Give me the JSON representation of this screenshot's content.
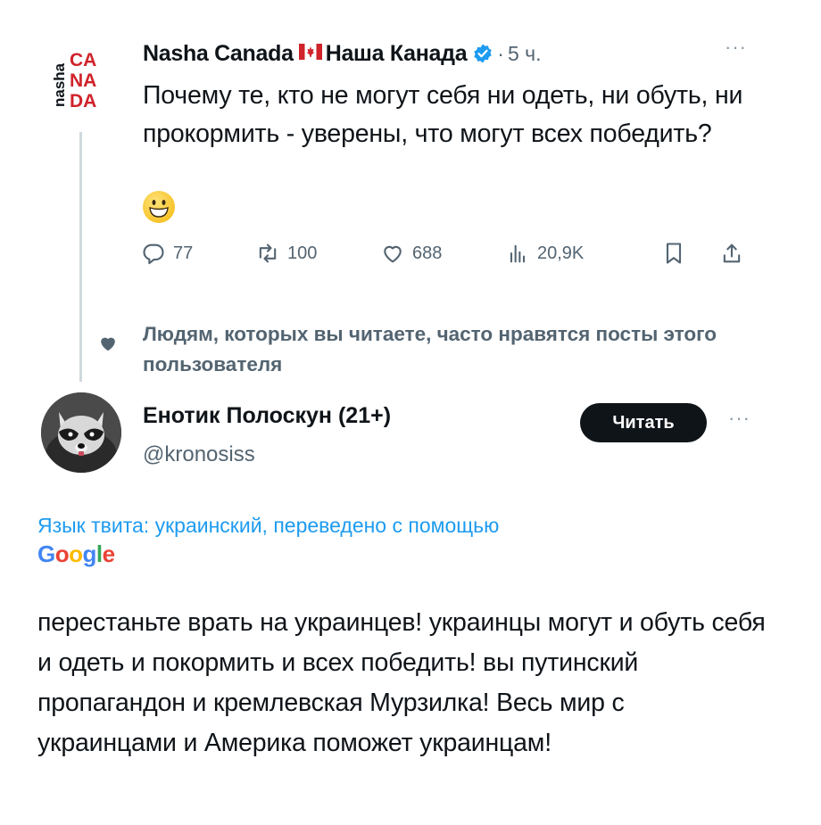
{
  "tweet1": {
    "avatar_text": {
      "brand": "nasha",
      "word": [
        "CA",
        "NA",
        "DA"
      ]
    },
    "display_name_latin": "Nasha Canada",
    "display_name_cyrillic": "Наша Канада",
    "separator": "·",
    "time": "5 ч.",
    "text": "Почему те, кто не могут себя ни одеть, ни обуть, ни прокормить - уверены, что могут всех победить?",
    "actions": {
      "replies": "77",
      "reposts": "100",
      "likes": "688",
      "views": "20,9K"
    }
  },
  "social_context": {
    "text": "Людям, которых вы читаете, часто нравятся посты этого пользователя"
  },
  "tweet2": {
    "display_name": "Енотик Полоскун (21+)",
    "handle": "@kronosiss",
    "follow_label": "Читать",
    "translation_note": "Язык твита: украинский, переведено с помощью",
    "google_letters": [
      "G",
      "o",
      "o",
      "g",
      "l",
      "e"
    ],
    "text": "перестаньте врать на украинцев! украинцы могут и обуть себя и одеть и покормить и всех победить! вы путинский пропагандон и кремлевская Мурзилка! Весь мир с украинцами и Америка поможет украинцам!"
  },
  "colors": {
    "brand_red": "#d0232a",
    "verified_blue": "#1d9bf0",
    "muted": "#536471",
    "google": [
      "#4285f4",
      "#ea4335",
      "#fbbc05",
      "#4285f4",
      "#34a853",
      "#ea4335"
    ]
  },
  "icons": {
    "reply": "speech-bubble",
    "repost": "retweet-arrows",
    "like": "heart-outline",
    "views": "bar-chart",
    "bookmark": "bookmark",
    "share": "share-arrow-up"
  }
}
